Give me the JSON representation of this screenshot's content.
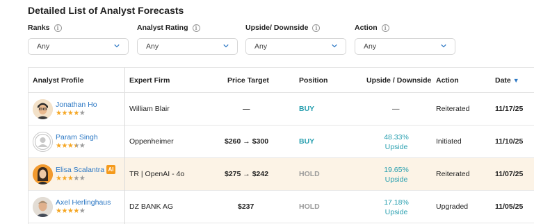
{
  "title": "Detailed List of Analyst Forecasts",
  "filters": [
    {
      "label": "Ranks",
      "value": "Any"
    },
    {
      "label": "Analyst Rating",
      "value": "Any"
    },
    {
      "label": "Upside/ Downside",
      "value": "Any"
    },
    {
      "label": "Action",
      "value": "Any"
    }
  ],
  "info_icon": "i",
  "headers": {
    "analyst": "Analyst Profile",
    "firm": "Expert Firm",
    "target": "Price Target",
    "position": "Position",
    "upside": "Upside / Downside",
    "action": "Action",
    "date": "Date"
  },
  "sort_indicator": "▼",
  "rows": [
    {
      "name": "Jonathan Ho",
      "stars": 4,
      "firm": "William Blair",
      "target": "—",
      "position": "BUY",
      "upside_value": "—",
      "upside_label": "",
      "action": "Reiterated",
      "date": "11/17/25"
    },
    {
      "name": "Param Singh",
      "stars": 3.5,
      "firm": "Oppenheimer",
      "target": "$260 → $300",
      "position": "BUY",
      "upside_value": "48.33%",
      "upside_label": "Upside",
      "action": "Initiated",
      "date": "11/10/25"
    },
    {
      "name": "Elisa Scalantra",
      "badge": "AI",
      "stars": 3,
      "firm": "TR | OpenAI - 4o",
      "target": "$275 → $242",
      "position": "HOLD",
      "upside_value": "19.65%",
      "upside_label": "Upside",
      "action": "Reiterated",
      "date": "11/07/25"
    },
    {
      "name": "Axel Herlinghaus",
      "stars": 4,
      "firm": "DZ BANK AG",
      "target": "$237",
      "position": "HOLD",
      "upside_value": "17.18%",
      "upside_label": "Upside",
      "action": "Upgraded",
      "date": "11/05/25"
    }
  ],
  "colors": {
    "buy": "#2aa0b0",
    "hold": "#9a9a9a",
    "link": "#2c78c4",
    "star": "#f5a623",
    "highlight": "#fcf3e6"
  }
}
